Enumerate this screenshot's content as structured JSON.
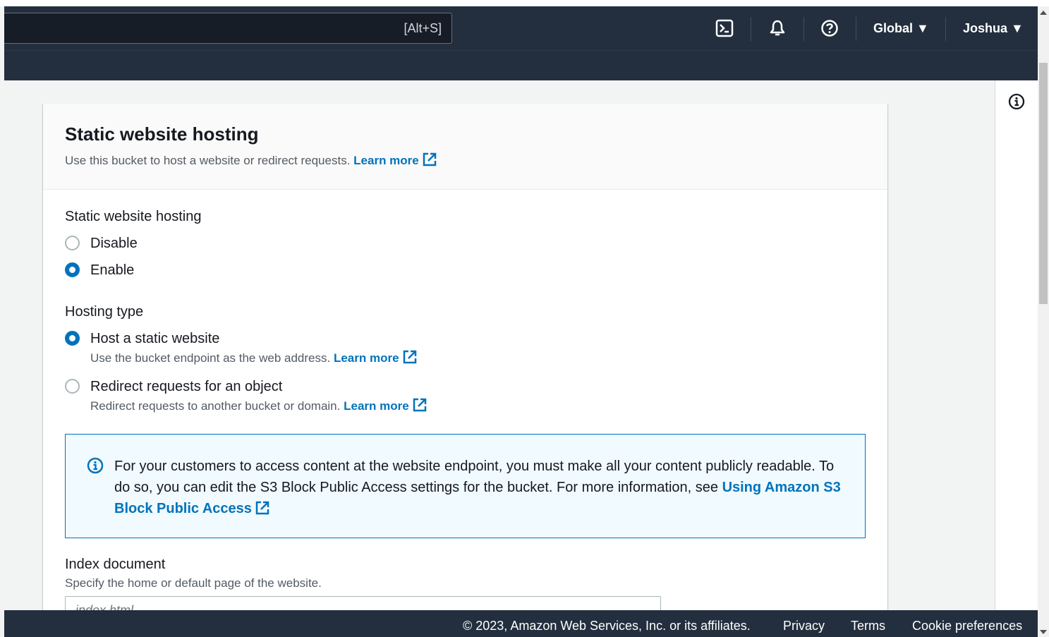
{
  "topnav": {
    "search_shortcut": "[Alt+S]",
    "cloudshell_icon": "cloudshell-icon",
    "bell_icon": "bell-icon",
    "help_icon": "help-icon",
    "region": "Global ▼",
    "user": "Joshua ▼"
  },
  "card": {
    "title": "Static website hosting",
    "description": "Use this bucket to host a website or redirect requests.",
    "learn_more": "Learn more"
  },
  "hosting": {
    "label": "Static website hosting",
    "options": [
      {
        "label": "Disable",
        "checked": false
      },
      {
        "label": "Enable",
        "checked": true
      }
    ]
  },
  "hosting_type": {
    "label": "Hosting type",
    "options": [
      {
        "label": "Host a static website",
        "description": "Use the bucket endpoint as the web address.",
        "learn_more": "Learn more",
        "checked": true
      },
      {
        "label": "Redirect requests for an object",
        "description": "Redirect requests to another bucket or domain.",
        "learn_more": "Learn more",
        "checked": false
      }
    ]
  },
  "alert": {
    "icon": "info-icon",
    "text": "For your customers to access content at the website endpoint, you must make all your content publicly readable. To do so, you can edit the S3 Block Public Access settings for the bucket. For more information, see",
    "link": "Using Amazon S3 Block Public Access"
  },
  "index_document": {
    "label": "Index document",
    "description": "Specify the home or default page of the website.",
    "placeholder": "index.html"
  },
  "footer": {
    "copyright": "© 2023, Amazon Web Services, Inc. or its affiliates.",
    "privacy": "Privacy",
    "terms": "Terms",
    "cookies": "Cookie preferences"
  },
  "colors": {
    "nav_bg": "#232f3e",
    "link": "#0073bb",
    "alert_bg": "#f1faff"
  }
}
